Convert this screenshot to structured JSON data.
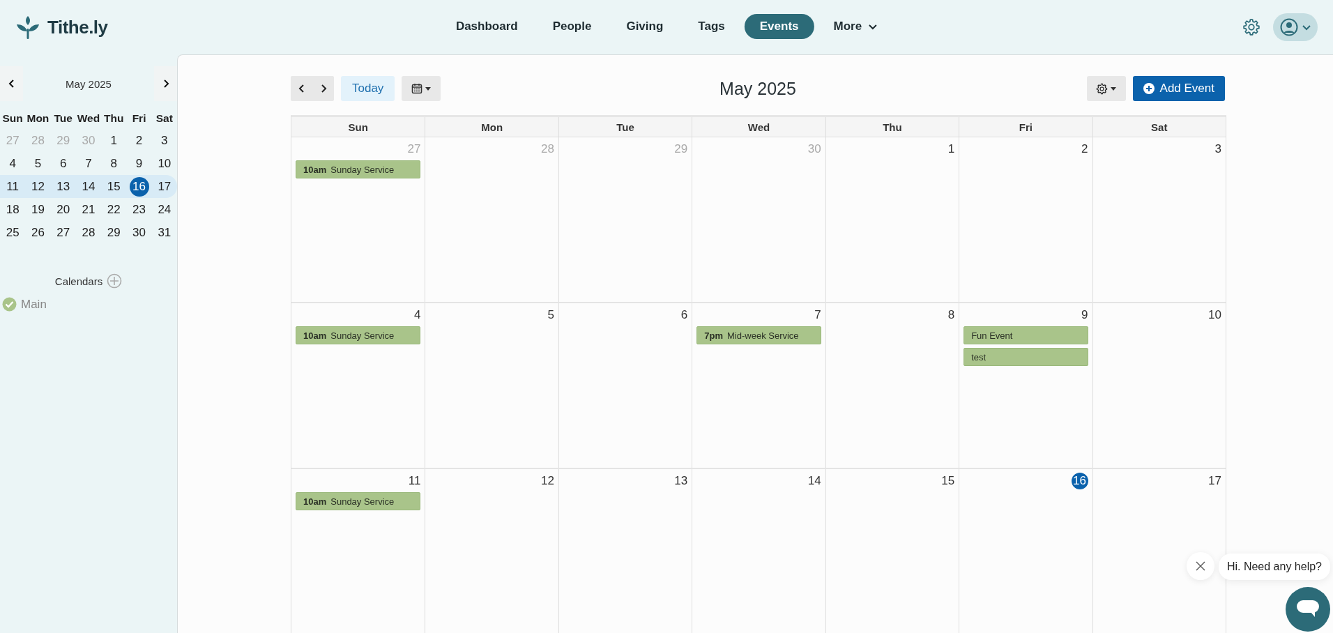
{
  "header": {
    "logo": "Tithe.ly",
    "nav": [
      {
        "label": "Dashboard",
        "selected": false,
        "kind": "link"
      },
      {
        "label": "People",
        "selected": false,
        "kind": "link"
      },
      {
        "label": "Giving",
        "selected": false,
        "kind": "link"
      },
      {
        "label": "Tags",
        "selected": false,
        "kind": "link"
      },
      {
        "label": "Events",
        "selected": true,
        "kind": "link"
      },
      {
        "label": "More",
        "selected": false,
        "kind": "dropdown"
      }
    ]
  },
  "mini_calendar": {
    "title": "May 2025",
    "weekdays": [
      "Sun",
      "Mon",
      "Tue",
      "Wed",
      "Thu",
      "Fri",
      "Sat"
    ],
    "weeks": [
      {
        "selected": false,
        "days": [
          {
            "day": "27",
            "muted": true,
            "today": false
          },
          {
            "day": "28",
            "muted": true,
            "today": false
          },
          {
            "day": "29",
            "muted": true,
            "today": false
          },
          {
            "day": "30",
            "muted": true,
            "today": false
          },
          {
            "day": "1",
            "muted": false,
            "today": false
          },
          {
            "day": "2",
            "muted": false,
            "today": false
          },
          {
            "day": "3",
            "muted": false,
            "today": false
          }
        ]
      },
      {
        "selected": false,
        "days": [
          {
            "day": "4",
            "muted": false,
            "today": false
          },
          {
            "day": "5",
            "muted": false,
            "today": false
          },
          {
            "day": "6",
            "muted": false,
            "today": false
          },
          {
            "day": "7",
            "muted": false,
            "today": false
          },
          {
            "day": "8",
            "muted": false,
            "today": false
          },
          {
            "day": "9",
            "muted": false,
            "today": false
          },
          {
            "day": "10",
            "muted": false,
            "today": false
          }
        ]
      },
      {
        "selected": true,
        "days": [
          {
            "day": "11",
            "muted": false,
            "today": false
          },
          {
            "day": "12",
            "muted": false,
            "today": false
          },
          {
            "day": "13",
            "muted": false,
            "today": false
          },
          {
            "day": "14",
            "muted": false,
            "today": false
          },
          {
            "day": "15",
            "muted": false,
            "today": false
          },
          {
            "day": "16",
            "muted": false,
            "today": true
          },
          {
            "day": "17",
            "muted": false,
            "today": false
          }
        ]
      },
      {
        "selected": false,
        "days": [
          {
            "day": "18",
            "muted": false,
            "today": false
          },
          {
            "day": "19",
            "muted": false,
            "today": false
          },
          {
            "day": "20",
            "muted": false,
            "today": false
          },
          {
            "day": "21",
            "muted": false,
            "today": false
          },
          {
            "day": "22",
            "muted": false,
            "today": false
          },
          {
            "day": "23",
            "muted": false,
            "today": false
          },
          {
            "day": "24",
            "muted": false,
            "today": false
          }
        ]
      },
      {
        "selected": false,
        "days": [
          {
            "day": "25",
            "muted": false,
            "today": false
          },
          {
            "day": "26",
            "muted": false,
            "today": false
          },
          {
            "day": "27",
            "muted": false,
            "today": false
          },
          {
            "day": "28",
            "muted": false,
            "today": false
          },
          {
            "day": "29",
            "muted": false,
            "today": false
          },
          {
            "day": "30",
            "muted": false,
            "today": false
          },
          {
            "day": "31",
            "muted": false,
            "today": false
          }
        ]
      }
    ]
  },
  "calendars": {
    "title": "Calendars",
    "items": [
      {
        "name": "Main",
        "checked": true
      }
    ]
  },
  "toolbar": {
    "today": "Today",
    "title": "May 2025",
    "add_event": "Add Event"
  },
  "month": {
    "weekdays": [
      "Sun",
      "Mon",
      "Tue",
      "Wed",
      "Thu",
      "Fri",
      "Sat"
    ],
    "weeks": [
      {
        "days": [
          {
            "day": "27",
            "muted": true,
            "today": false,
            "events": [
              {
                "time": "10am",
                "title": "Sunday Service"
              }
            ]
          },
          {
            "day": "28",
            "muted": true,
            "today": false
          },
          {
            "day": "29",
            "muted": true,
            "today": false
          },
          {
            "day": "30",
            "muted": true,
            "today": false
          },
          {
            "day": "1",
            "muted": false,
            "today": false
          },
          {
            "day": "2",
            "muted": false,
            "today": false
          },
          {
            "day": "3",
            "muted": false,
            "today": false
          }
        ]
      },
      {
        "days": [
          {
            "day": "4",
            "muted": false,
            "today": false,
            "events": [
              {
                "time": "10am",
                "title": "Sunday Service"
              }
            ]
          },
          {
            "day": "5",
            "muted": false,
            "today": false
          },
          {
            "day": "6",
            "muted": false,
            "today": false
          },
          {
            "day": "7",
            "muted": false,
            "today": false,
            "events": [
              {
                "time": "7pm",
                "title": "Mid-week Service"
              }
            ]
          },
          {
            "day": "8",
            "muted": false,
            "today": false
          },
          {
            "day": "9",
            "muted": false,
            "today": false,
            "events": [
              {
                "title": "Fun Event"
              },
              {
                "title": "test"
              }
            ]
          },
          {
            "day": "10",
            "muted": false,
            "today": false
          }
        ]
      },
      {
        "days": [
          {
            "day": "11",
            "muted": false,
            "today": false,
            "events": [
              {
                "time": "10am",
                "title": "Sunday Service"
              }
            ]
          },
          {
            "day": "12",
            "muted": false,
            "today": false
          },
          {
            "day": "13",
            "muted": false,
            "today": false
          },
          {
            "day": "14",
            "muted": false,
            "today": false
          },
          {
            "day": "15",
            "muted": false,
            "today": false
          },
          {
            "day": "16",
            "muted": false,
            "today": true
          },
          {
            "day": "17",
            "muted": false,
            "today": false
          }
        ]
      }
    ]
  },
  "chat": {
    "message": "Hi. Need any help?"
  }
}
